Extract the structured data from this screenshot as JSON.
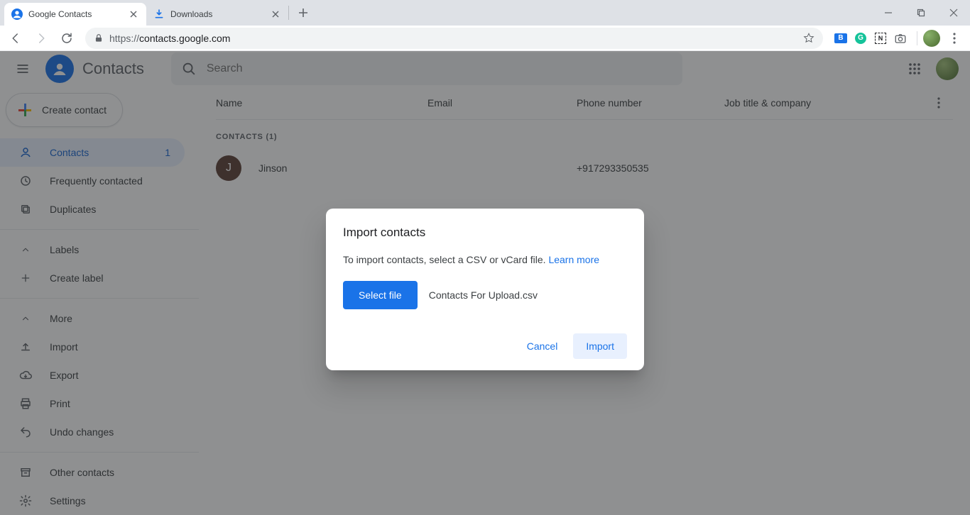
{
  "browser": {
    "tabs": [
      {
        "title": "Google Contacts",
        "active": true
      },
      {
        "title": "Downloads",
        "active": false
      }
    ],
    "url_protocol": "https://",
    "url_host": "contacts.google.com"
  },
  "app": {
    "title": "Contacts",
    "search_placeholder": "Search",
    "create_button": "Create contact"
  },
  "sidebar": {
    "items": {
      "contacts": {
        "label": "Contacts",
        "count": "1"
      },
      "frequent": {
        "label": "Frequently contacted"
      },
      "duplicates": {
        "label": "Duplicates"
      },
      "labels": {
        "label": "Labels"
      },
      "create_label": {
        "label": "Create label"
      },
      "more": {
        "label": "More"
      },
      "import": {
        "label": "Import"
      },
      "export": {
        "label": "Export"
      },
      "print": {
        "label": "Print"
      },
      "undo": {
        "label": "Undo changes"
      },
      "other": {
        "label": "Other contacts"
      },
      "settings": {
        "label": "Settings"
      }
    }
  },
  "columns": {
    "name": "Name",
    "email": "Email",
    "phone": "Phone number",
    "job": "Job title & company"
  },
  "list": {
    "section_label": "CONTACTS (1)",
    "rows": [
      {
        "initial": "J",
        "name": "Jinson",
        "email": "",
        "phone": "+917293350535"
      }
    ]
  },
  "dialog": {
    "title": "Import contacts",
    "body_text": "To import contacts, select a CSV or vCard file. ",
    "learn_more": "Learn more",
    "select_file": "Select file",
    "file_name": "Contacts For Upload.csv",
    "cancel": "Cancel",
    "import": "Import"
  }
}
